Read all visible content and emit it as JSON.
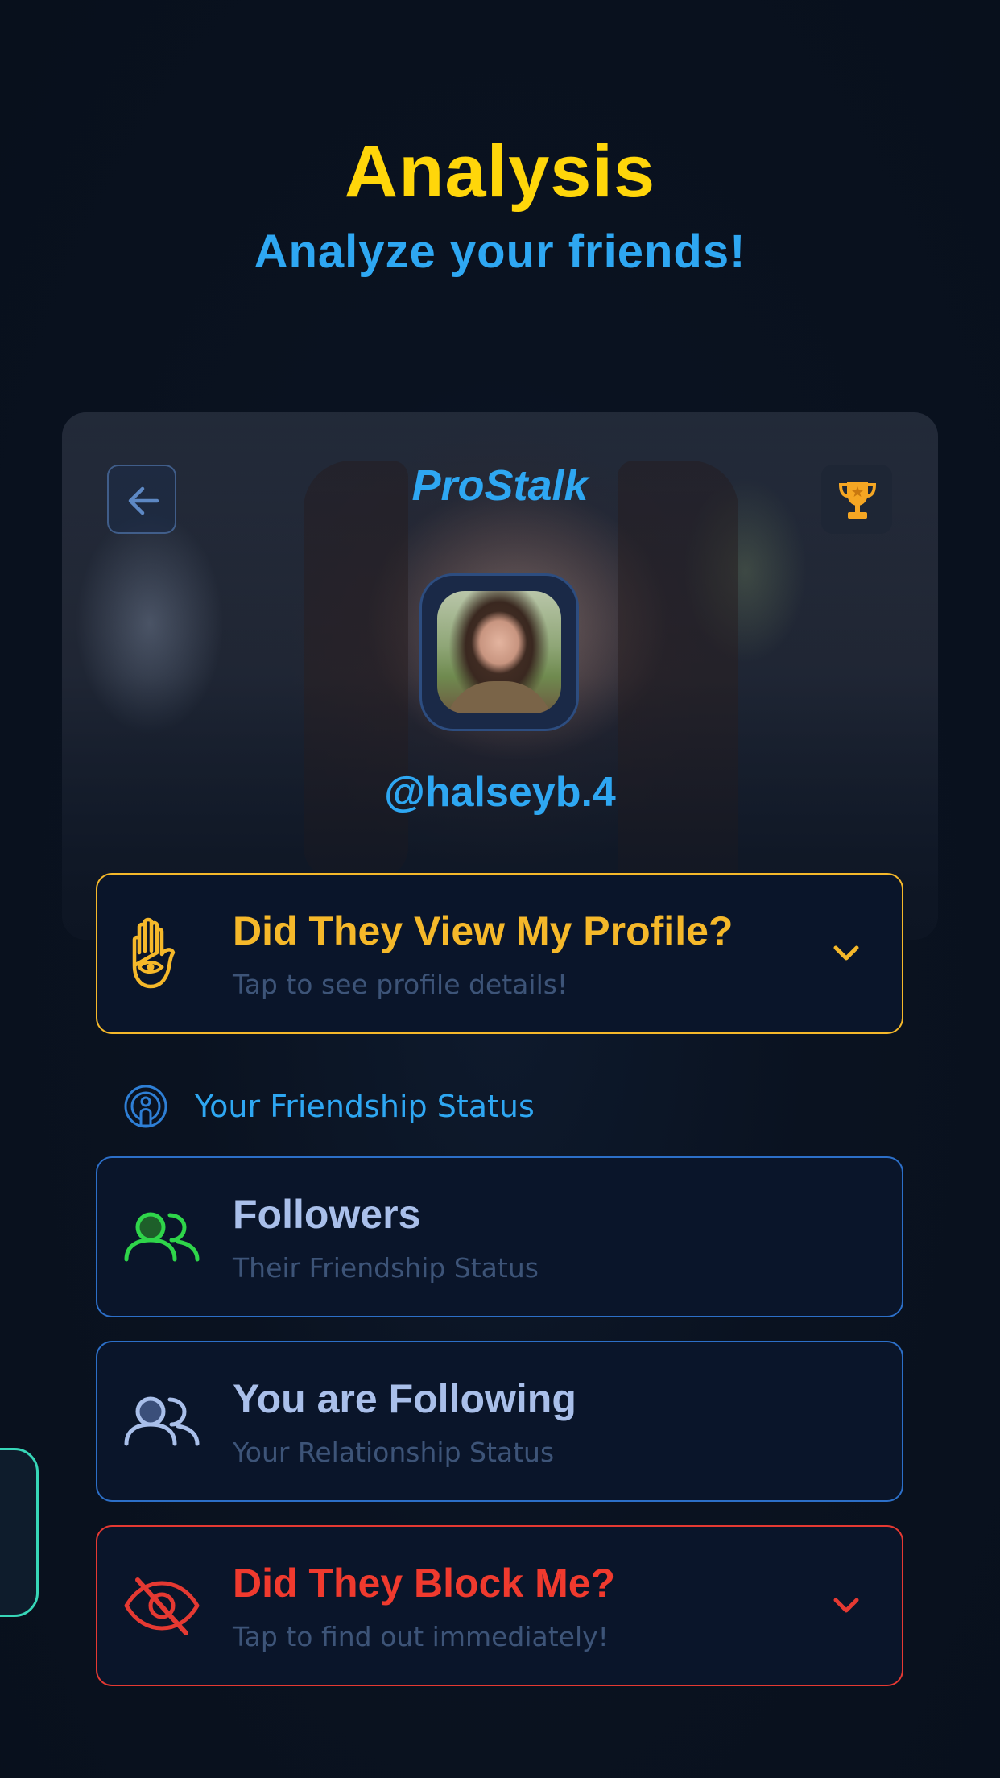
{
  "header": {
    "title": "Analysis",
    "subtitle": "Analyze your friends!"
  },
  "profile": {
    "brand": "ProStalk",
    "username": "@halseyb.4",
    "back_icon": "arrow-left-icon",
    "trophy_icon": "trophy-icon"
  },
  "cards": {
    "view_profile": {
      "title": "Did They View My Profile?",
      "subtitle": "Tap to see profile details!",
      "icon": "hamsa-eye-icon",
      "color": "#f5b82a"
    },
    "section_label": {
      "text": "Your Friendship Status",
      "icon": "podcast-person-icon"
    },
    "followers": {
      "title": "Followers",
      "subtitle": "Their Friendship Status",
      "icon": "users-icon",
      "color": "#2fd54a"
    },
    "following": {
      "title": "You are Following",
      "subtitle": "Your Relationship Status",
      "icon": "users-icon",
      "color": "#a9bfea"
    },
    "block": {
      "title": "Did They Block Me?",
      "subtitle": "Tap to find out immediately!",
      "icon": "eye-slash-icon",
      "color": "#f03a2e"
    }
  },
  "colors": {
    "accent_yellow": "#ffd60a",
    "accent_blue": "#2ea7f2",
    "background": "#0a1120",
    "side_tab_border": "#37d6b8"
  }
}
